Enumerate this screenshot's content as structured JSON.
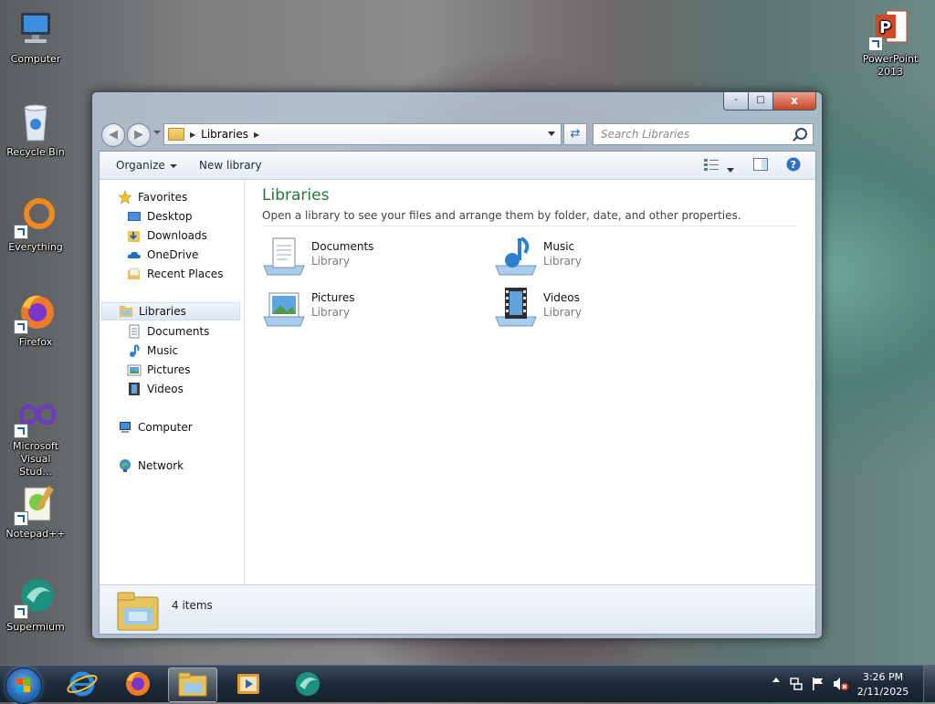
{
  "desktop": {
    "icons": [
      {
        "label": "Computer"
      },
      {
        "label": "Recycle Bin"
      },
      {
        "label": "Everything"
      },
      {
        "label": "Firefox"
      },
      {
        "label": "Microsoft Visual Stud..."
      },
      {
        "label": "Notepad++"
      },
      {
        "label": "Supermium"
      },
      {
        "label": "PowerPoint 2013"
      }
    ]
  },
  "window": {
    "caption": {
      "minimize": "-",
      "maximize": "□",
      "close": "x"
    },
    "address": {
      "crumb": "Libraries"
    },
    "search": {
      "placeholder": "Search Libraries"
    },
    "toolbar": {
      "organize": "Organize",
      "new_library": "New library"
    },
    "nav": {
      "favorites": "Favorites",
      "desktop": "Desktop",
      "downloads": "Downloads",
      "onedrive": "OneDrive",
      "recent_places": "Recent Places",
      "libraries": "Libraries",
      "documents": "Documents",
      "music": "Music",
      "pictures": "Pictures",
      "videos": "Videos",
      "computer": "Computer",
      "network": "Network"
    },
    "content": {
      "title": "Libraries",
      "subtitle": "Open a library to see your files and arrange them by folder, date, and other properties.",
      "libraries": [
        {
          "name": "Documents",
          "kind": "Library"
        },
        {
          "name": "Music",
          "kind": "Library"
        },
        {
          "name": "Pictures",
          "kind": "Library"
        },
        {
          "name": "Videos",
          "kind": "Library"
        }
      ]
    },
    "details": {
      "count": "4 items"
    }
  },
  "taskbar": {
    "apps": [
      "start",
      "internet-explorer",
      "firefox",
      "file-explorer",
      "media-player",
      "supermium"
    ],
    "clock": {
      "time": "3:26 PM",
      "date": "2/11/2025"
    }
  },
  "colors": {
    "content_title": "#1e7a3a",
    "close_button": "#c9452a",
    "taskbar": "#1f2c3b"
  }
}
